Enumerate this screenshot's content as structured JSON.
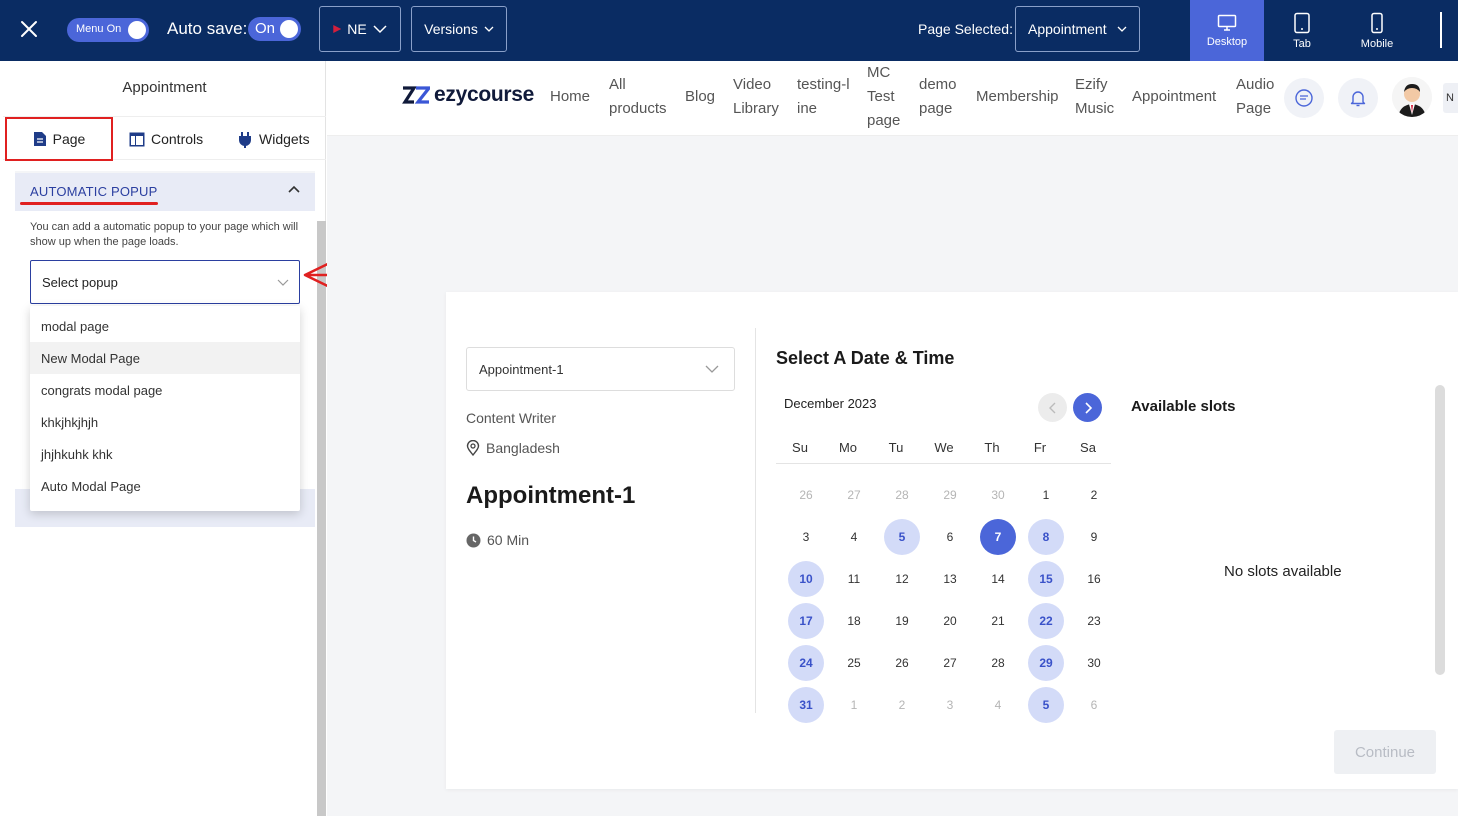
{
  "topbar": {
    "menu_toggle_label": "Menu On",
    "autosave_label": "Auto save:",
    "autosave_state": "On",
    "language": "NE",
    "versions_label": "Versions",
    "page_selected_label": "Page Selected:",
    "page_selected_value": "Appointment",
    "devices": [
      {
        "label": "Desktop",
        "icon": "desktop-icon"
      },
      {
        "label": "Tab",
        "icon": "tablet-icon"
      },
      {
        "label": "Mobile",
        "icon": "mobile-icon"
      }
    ],
    "active_device": "Desktop",
    "accent_color": "#4b66d9",
    "bar_color": "#0a2c63"
  },
  "sidebar": {
    "title": "Appointment",
    "tabs": [
      {
        "label": "Page",
        "icon": "page-icon"
      },
      {
        "label": "Controls",
        "icon": "layout-icon"
      },
      {
        "label": "Widgets",
        "icon": "plug-icon"
      }
    ],
    "section": {
      "title": "AUTOMATIC POPUP",
      "description": "You can add a automatic popup to your page which will show up when the page loads.",
      "select_placeholder": "Select popup",
      "options": [
        "modal page",
        "New Modal Page",
        "congrats modal page",
        "khkjhkjhjh",
        "jhjhkuhk khk",
        "Auto Modal Page"
      ],
      "hovered_option": "New Modal Page"
    }
  },
  "site": {
    "logo": "ezycourse",
    "nav": [
      "Home",
      "All products",
      "Blog",
      "Video Library",
      "testing-line",
      "MC Test page",
      "demo page",
      "Membership",
      "Ezify Music",
      "Appointment",
      "Audio Page"
    ],
    "nav_cut_text": "N"
  },
  "appointment": {
    "select_value": "Appointment-1",
    "role": "Content Writer",
    "location": "Bangladesh",
    "title": "Appointment-1",
    "duration": "60 Min",
    "calendar_heading": "Select A Date & Time",
    "month": "December 2023",
    "weekdays": [
      "Su",
      "Mo",
      "Tu",
      "We",
      "Th",
      "Fr",
      "Sa"
    ],
    "weeks": [
      [
        "26",
        "27",
        "28",
        "29",
        "30",
        "1",
        "2"
      ],
      [
        "3",
        "4",
        "5",
        "6",
        "7",
        "8",
        "9"
      ],
      [
        "10",
        "11",
        "12",
        "13",
        "14",
        "15",
        "16"
      ],
      [
        "17",
        "18",
        "19",
        "20",
        "21",
        "22",
        "23"
      ],
      [
        "24",
        "25",
        "26",
        "27",
        "28",
        "29",
        "30"
      ],
      [
        "31",
        "1",
        "2",
        "3",
        "4",
        "5",
        "6"
      ]
    ],
    "selected_day": "7",
    "available_days": [
      "8",
      "10",
      "15",
      "17",
      "22",
      "24",
      "29",
      "31",
      "5"
    ],
    "slots_title": "Available slots",
    "no_slots": "No slots available",
    "continue_label": "Continue"
  }
}
